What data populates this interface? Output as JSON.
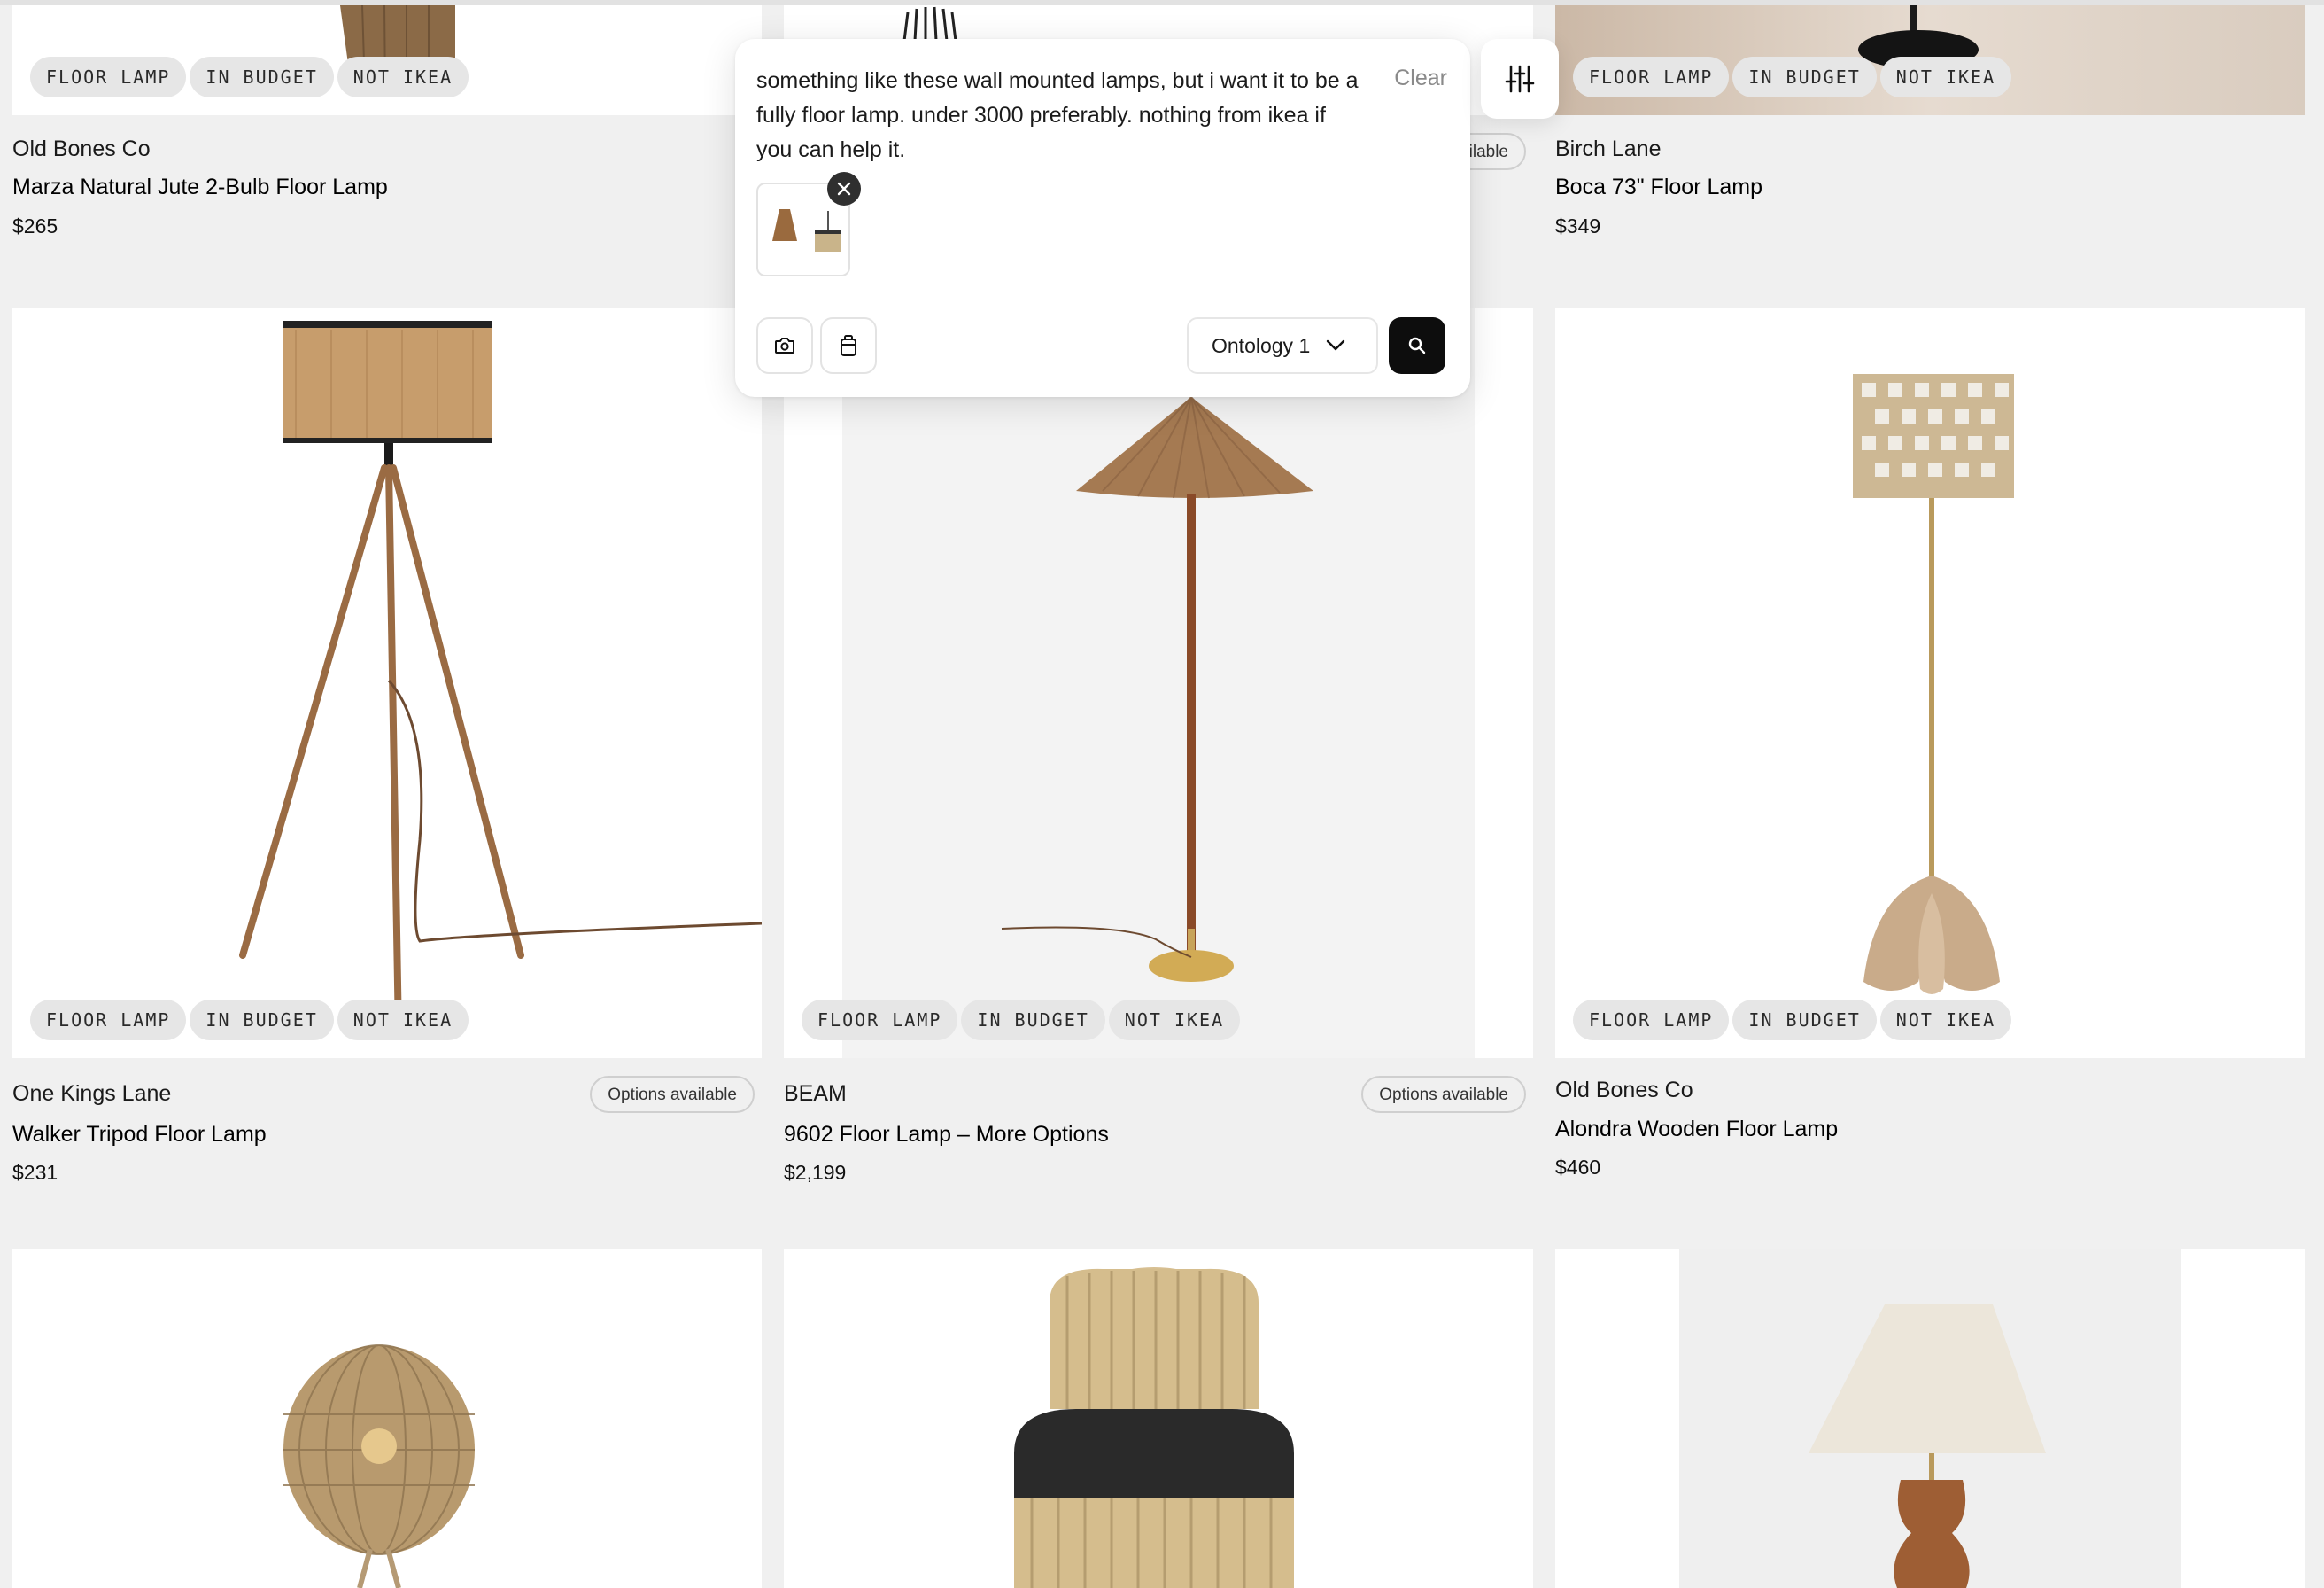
{
  "search": {
    "query": "something like these wall mounted lamps, but i want it to be a fully floor lamp. under 3000 preferably. nothing from ikea if you can help it.",
    "clear_label": "Clear",
    "ontology_label": "Ontology 1"
  },
  "tags": [
    "FLOOR LAMP",
    "IN BUDGET",
    "NOT IKEA"
  ],
  "options_label": "Options available",
  "products": [
    {
      "brand": "Old Bones Co",
      "title": "Marza Natural Jute 2-Bulb Floor Lamp",
      "price": "$265"
    },
    {
      "brand": "Birch Lane",
      "title": "Boca 73\" Floor Lamp",
      "price": "$349"
    },
    {
      "brand": "One Kings Lane",
      "title": "Walker Tripod Floor Lamp",
      "price": "$231"
    },
    {
      "brand": "BEAM",
      "title": "9602 Floor Lamp – More Options",
      "price": "$2,199"
    },
    {
      "brand": "Old Bones Co",
      "title": "Alondra Wooden Floor Lamp",
      "price": "$460"
    }
  ],
  "icons": {
    "camera": "camera-icon",
    "clipboard": "clipboard-icon",
    "chevron": "chevron-down-icon",
    "search": "search-icon",
    "filter": "sliders-icon",
    "remove": "close-icon"
  },
  "colors": {
    "accent_dark": "#0d0d0d",
    "tag_bg": "#e6e6e6",
    "page_bg": "#f0f0f0"
  }
}
